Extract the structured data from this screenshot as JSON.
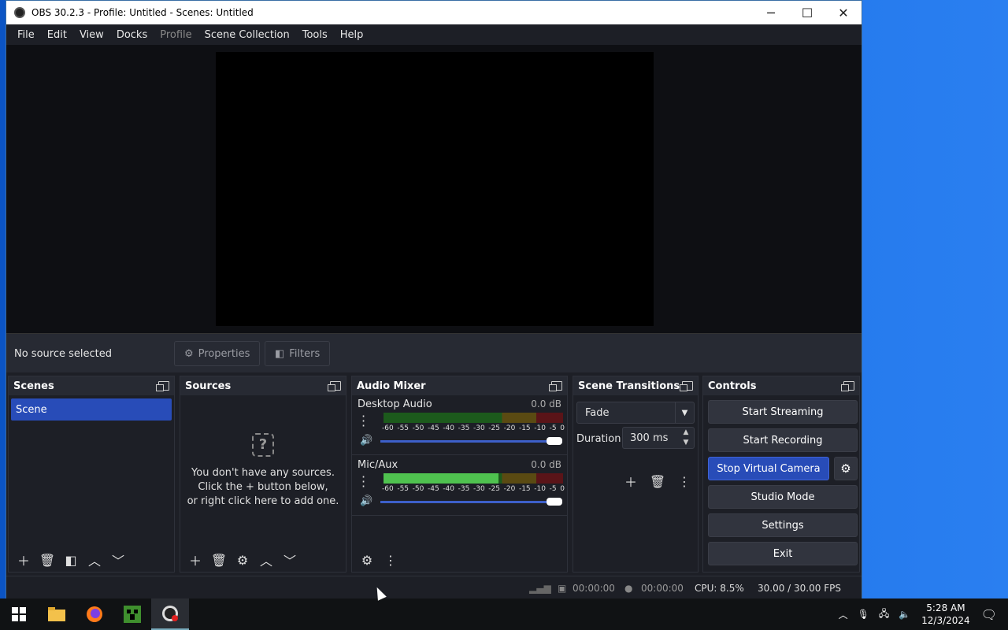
{
  "window": {
    "title": "OBS 30.2.3 - Profile: Untitled - Scenes: Untitled",
    "minimize": "─",
    "maximize": "☐",
    "close": "✕"
  },
  "menu": {
    "file": "File",
    "edit": "Edit",
    "view": "View",
    "docks": "Docks",
    "profile": "Profile",
    "scene_collection": "Scene Collection",
    "tools": "Tools",
    "help": "Help"
  },
  "source_bar": {
    "no_source": "No source selected",
    "properties": "Properties",
    "filters": "Filters"
  },
  "scenes": {
    "title": "Scenes",
    "items": [
      "Scene"
    ]
  },
  "sources": {
    "title": "Sources",
    "empty_line1": "You don't have any sources.",
    "empty_line2": "Click the + button below,",
    "empty_line3": "or right click here to add one."
  },
  "audio_mixer": {
    "title": "Audio Mixer",
    "scale": [
      "-60",
      "-55",
      "-50",
      "-45",
      "-40",
      "-35",
      "-30",
      "-25",
      "-20",
      "-15",
      "-10",
      "-5",
      "0"
    ],
    "channels": [
      {
        "name": "Desktop Audio",
        "db": "0.0 dB",
        "level": 0.0,
        "volume": 1.0
      },
      {
        "name": "Mic/Aux",
        "db": "0.0 dB",
        "level": 0.64,
        "volume": 1.0
      }
    ]
  },
  "transitions": {
    "title": "Scene Transitions",
    "selected": "Fade",
    "duration_label": "Duration",
    "duration_value": "300 ms"
  },
  "controls": {
    "title": "Controls",
    "start_streaming": "Start Streaming",
    "start_recording": "Start Recording",
    "stop_virtual_camera": "Stop Virtual Camera",
    "studio_mode": "Studio Mode",
    "settings": "Settings",
    "exit": "Exit"
  },
  "status": {
    "stream_time": "00:00:00",
    "record_time": "00:00:00",
    "cpu": "CPU: 8.5%",
    "fps": "30.00 / 30.00 FPS"
  },
  "taskbar": {
    "time": "5:28 AM",
    "date": "12/3/2024"
  },
  "colors": {
    "accent": "#284cb8",
    "panel": "#1d1f26",
    "header": "#272a33",
    "meter_green": "#4fc24f"
  }
}
